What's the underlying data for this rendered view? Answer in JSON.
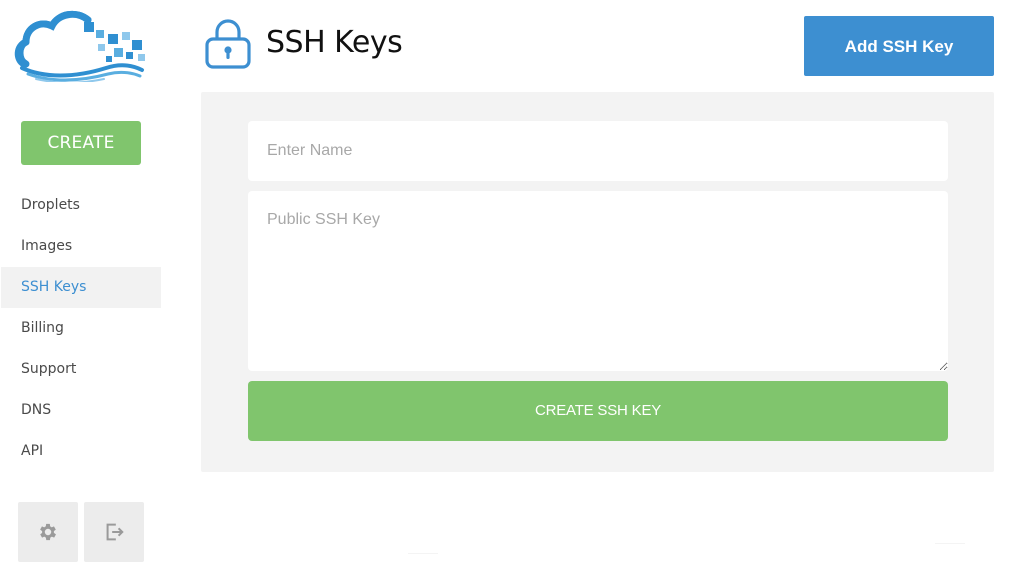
{
  "sidebar": {
    "logo_icon": "cloud-logo",
    "create_label": "CREATE",
    "items": [
      {
        "label": "Droplets",
        "active": false
      },
      {
        "label": "Images",
        "active": false
      },
      {
        "label": "SSH Keys",
        "active": true
      },
      {
        "label": "Billing",
        "active": false
      },
      {
        "label": "Support",
        "active": false
      },
      {
        "label": "DNS",
        "active": false
      },
      {
        "label": "API",
        "active": false
      }
    ],
    "footer_icons": [
      "gear-icon",
      "logout-icon"
    ]
  },
  "header": {
    "icon": "lock-icon",
    "title": "SSH Keys",
    "add_button_label": "Add SSH Key"
  },
  "form": {
    "name_placeholder": "Enter Name",
    "name_value": "",
    "key_placeholder": "Public SSH Key",
    "key_value": "",
    "submit_label": "CREATE SSH KEY"
  },
  "colors": {
    "accent_blue": "#3d8fd1",
    "accent_green": "#80c56d",
    "panel_bg": "#f3f3f3"
  }
}
